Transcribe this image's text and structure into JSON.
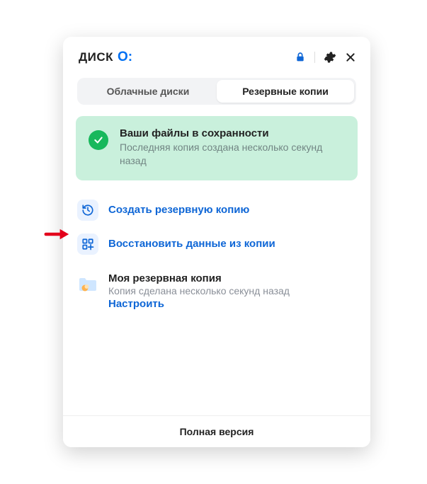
{
  "header": {
    "logo_text": "ДИСК",
    "logo_suffix": "O:"
  },
  "tabs": {
    "cloud_disks": "Облачные диски",
    "backups": "Резервные копии"
  },
  "status": {
    "title": "Ваши файлы в сохранности",
    "subtitle": "Последняя копия создана несколько секунд назад"
  },
  "actions": {
    "create_backup": "Создать резервную копию",
    "restore_data": "Восстановить данные из копии"
  },
  "backup": {
    "title": "Моя резервная копия",
    "subtitle": "Копия сделана несколько секунд назад",
    "configure": "Настроить"
  },
  "footer": {
    "full_version": "Полная версия"
  },
  "colors": {
    "accent": "#0e66d6",
    "success_bg": "#c9f0dc",
    "success": "#18b85c"
  }
}
